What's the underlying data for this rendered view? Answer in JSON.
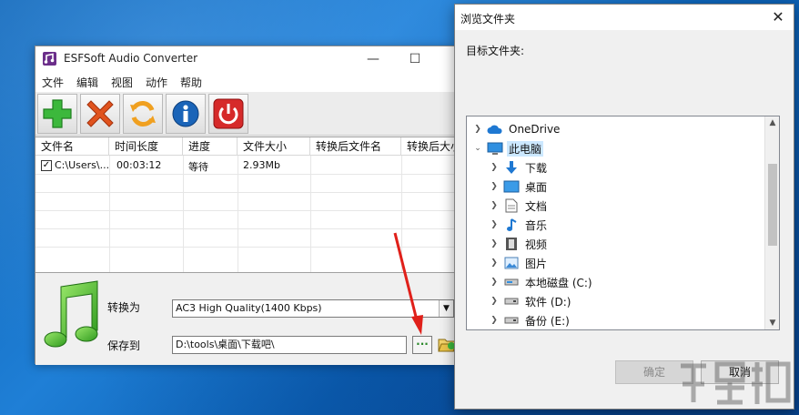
{
  "app": {
    "title": "ESFSoft Audio Converter",
    "window_controls": {
      "minimize": "—",
      "maximize": "☐"
    },
    "menu": [
      "文件",
      "编辑",
      "视图",
      "动作",
      "帮助"
    ],
    "toolbar": [
      {
        "name": "add",
        "icon": "plus-icon",
        "color": "#3cb83c"
      },
      {
        "name": "remove",
        "icon": "x-icon",
        "color": "#d9451a"
      },
      {
        "name": "convert",
        "icon": "refresh-icon",
        "color": "#f0a020"
      },
      {
        "name": "info",
        "icon": "info-icon",
        "color": "#1a64b8"
      },
      {
        "name": "power",
        "icon": "power-icon",
        "color": "#d62a2a"
      }
    ],
    "columns": [
      "文件名",
      "时间长度",
      "进度",
      "文件大小",
      "转换后文件名",
      "转换后大小"
    ],
    "rows": [
      {
        "checked": true,
        "filename": "C:\\Users\\...",
        "duration": "00:03:12",
        "progress": "等待",
        "size": "2.93Mb",
        "out_name": "",
        "out_size": ""
      }
    ],
    "convert_label": "转换为",
    "format_value": "AC3 High Quality(1400 Kbps)",
    "save_label": "保存到",
    "save_path": "D:\\tools\\桌面\\下载吧\\",
    "browse_label": "···"
  },
  "dialog": {
    "title": "浏览文件夹",
    "close": "✕",
    "target_label": "目标文件夹:",
    "tree": [
      {
        "label": "OneDrive",
        "icon": "cloud-icon",
        "level": 0,
        "expanded": false
      },
      {
        "label": "此电脑",
        "icon": "computer-icon",
        "level": 0,
        "expanded": true,
        "selected": true
      },
      {
        "label": "下载",
        "icon": "download-icon",
        "level": 1
      },
      {
        "label": "桌面",
        "icon": "desktop-icon",
        "level": 1
      },
      {
        "label": "文档",
        "icon": "document-icon",
        "level": 1
      },
      {
        "label": "音乐",
        "icon": "music-icon",
        "level": 1
      },
      {
        "label": "视频",
        "icon": "video-icon",
        "level": 1
      },
      {
        "label": "图片",
        "icon": "picture-icon",
        "level": 1
      },
      {
        "label": "本地磁盘 (C:)",
        "icon": "drive-icon",
        "level": 1
      },
      {
        "label": "软件 (D:)",
        "icon": "drive-icon",
        "level": 1
      },
      {
        "label": "备份 (E:)",
        "icon": "drive-icon",
        "level": 1
      }
    ],
    "ok_label": "确定",
    "cancel_label": "取消"
  },
  "colors": {
    "accent": "#0078d7",
    "selection": "#cce8ff",
    "arrow": "#e0201a"
  }
}
